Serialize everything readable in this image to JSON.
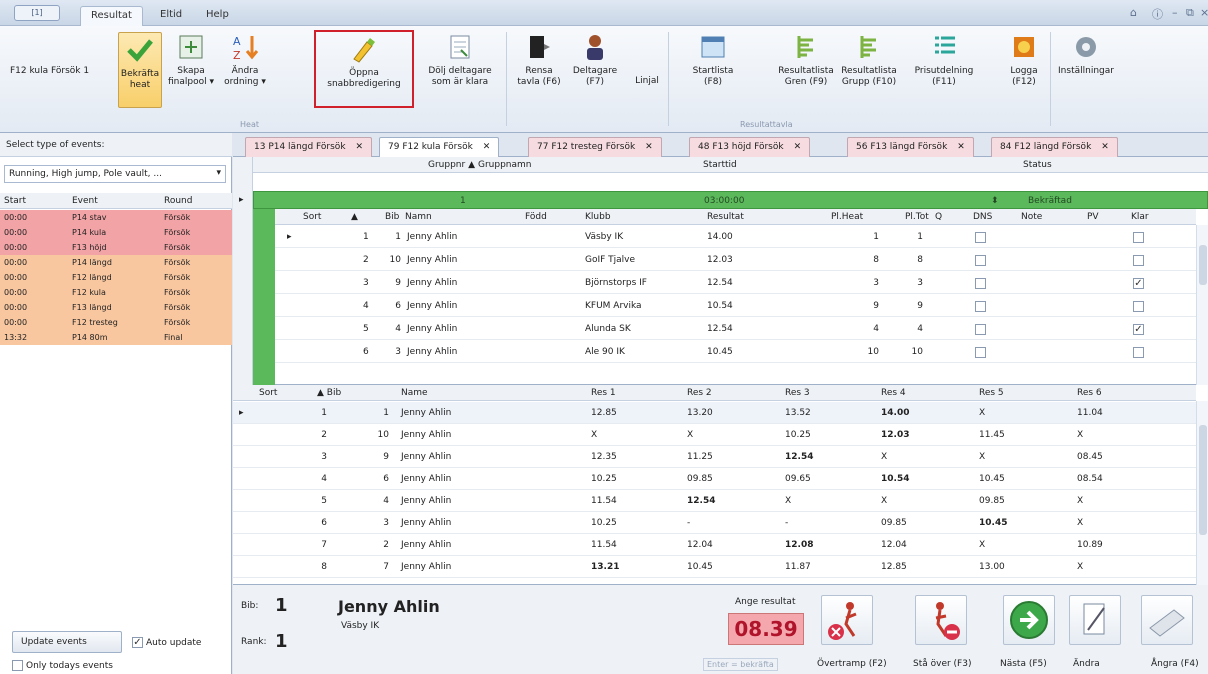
{
  "titlebar": {
    "qat": "[1]",
    "tabs": [
      "Resultat",
      "Eltid",
      "Help"
    ]
  },
  "ribbon": {
    "event_label": "F12 kula Försök 1",
    "buttons": [
      "Bekräfta heat",
      "Skapa finalpool ▾",
      "Ändra ordning ▾",
      "Öppna snabbredigering",
      "Dölj deltagare som är klara",
      "Rensa tavla (F6)",
      "Deltagare (F7)",
      "Linjal",
      "Startlista (F8)",
      "Resultatlista Gren (F9)",
      "Resultatlista Grupp (F10)",
      "Prisutdelning (F11)",
      "Logga (F12)",
      "Inställningar"
    ],
    "groups": [
      "Heat",
      "Resultattavla"
    ]
  },
  "left": {
    "title": "Select type of events:",
    "combo": "Running, High jump, Pole vault, ...",
    "headers": [
      "Start",
      "Event",
      "Round"
    ],
    "rows": [
      {
        "start": "00:00",
        "event": "P14 stav",
        "round": "Försök",
        "color": "pink"
      },
      {
        "start": "00:00",
        "event": "P14 kula",
        "round": "Försök",
        "color": "pink"
      },
      {
        "start": "00:00",
        "event": "F13 höjd",
        "round": "Försök",
        "color": "pink"
      },
      {
        "start": "00:00",
        "event": "P14 längd",
        "round": "Försök",
        "color": "orange"
      },
      {
        "start": "00:00",
        "event": "F12 längd",
        "round": "Försök",
        "color": "orange"
      },
      {
        "start": "00:00",
        "event": "F12 kula",
        "round": "Försök",
        "color": "orange"
      },
      {
        "start": "00:00",
        "event": "F13 längd",
        "round": "Försök",
        "color": "orange"
      },
      {
        "start": "00:00",
        "event": "F12 tresteg",
        "round": "Försök",
        "color": "orange"
      },
      {
        "start": "13:32",
        "event": "P14 80m",
        "round": "Final",
        "color": "orange"
      }
    ],
    "update_button": "Update events",
    "auto_update": "Auto update",
    "only_today": "Only todays events"
  },
  "doc_tabs": [
    "13 P14 längd Försök",
    "79 F12 kula Försök",
    "77 F12 tresteg Försök",
    "48 F13 höjd Försök",
    "56 F13 längd Försök",
    "84 F12 längd Försök"
  ],
  "grid1": {
    "group_headers": [
      "Gruppnr ▲",
      "Gruppnamn",
      "Starttid",
      "Status"
    ],
    "group_row": {
      "nr": "1",
      "time": "03:00:00",
      "status": "Bekräftad"
    },
    "headers": [
      "Sort",
      "Bib",
      "Namn",
      "Född",
      "Klubb",
      "Resultat",
      "Pl.Heat",
      "Pl.Tot",
      "Q",
      "DNS",
      "Note",
      "PV",
      "Klar"
    ],
    "rows": [
      {
        "sort": "1",
        "bib": "1",
        "name": "Jenny Ahlin",
        "club": "Väsby IK",
        "res": "14.00",
        "plheat": "1",
        "pltot": "1",
        "klar": ""
      },
      {
        "sort": "2",
        "bib": "10",
        "name": "Jenny Ahlin",
        "club": "GoIF Tjalve",
        "res": "12.03",
        "plheat": "8",
        "pltot": "8",
        "klar": ""
      },
      {
        "sort": "3",
        "bib": "9",
        "name": "Jenny Ahlin",
        "club": "Björnstorps IF",
        "res": "12.54",
        "plheat": "3",
        "pltot": "3",
        "klar": "✓"
      },
      {
        "sort": "4",
        "bib": "6",
        "name": "Jenny Ahlin",
        "club": "KFUM Arvika",
        "res": "10.54",
        "plheat": "9",
        "pltot": "9",
        "klar": ""
      },
      {
        "sort": "5",
        "bib": "4",
        "name": "Jenny Ahlin",
        "club": "Alunda SK",
        "res": "12.54",
        "plheat": "4",
        "pltot": "4",
        "klar": "✓"
      },
      {
        "sort": "6",
        "bib": "3",
        "name": "Jenny Ahlin",
        "club": "Ale 90 IK",
        "res": "10.45",
        "plheat": "10",
        "pltot": "10",
        "klar": ""
      }
    ]
  },
  "grid2": {
    "headers": [
      "Sort",
      "▲ Bib",
      "Name",
      "Res 1",
      "Res 2",
      "Res 3",
      "Res 4",
      "Res 5",
      "Res 6"
    ],
    "rows": [
      {
        "sort": "1",
        "bib": "1",
        "name": "Jenny Ahlin",
        "r": [
          "12.85",
          "13.20",
          "13.52",
          "14.00",
          "X",
          "11.04"
        ],
        "best": 3
      },
      {
        "sort": "2",
        "bib": "10",
        "name": "Jenny Ahlin",
        "r": [
          "X",
          "X",
          "10.25",
          "12.03",
          "11.45",
          "X"
        ],
        "best": 3
      },
      {
        "sort": "3",
        "bib": "9",
        "name": "Jenny Ahlin",
        "r": [
          "12.35",
          "11.25",
          "12.54",
          "X",
          "X",
          "08.45"
        ],
        "best": 2
      },
      {
        "sort": "4",
        "bib": "6",
        "name": "Jenny Ahlin",
        "r": [
          "10.25",
          "09.85",
          "09.65",
          "10.54",
          "10.45",
          "08.54"
        ],
        "best": 3
      },
      {
        "sort": "5",
        "bib": "4",
        "name": "Jenny Ahlin",
        "r": [
          "11.54",
          "12.54",
          "X",
          "X",
          "09.85",
          "X"
        ],
        "best": 1
      },
      {
        "sort": "6",
        "bib": "3",
        "name": "Jenny Ahlin",
        "r": [
          "10.25",
          "-",
          "-",
          "09.85",
          "10.45",
          "X"
        ],
        "best": 4
      },
      {
        "sort": "7",
        "bib": "2",
        "name": "Jenny Ahlin",
        "r": [
          "11.54",
          "12.04",
          "12.08",
          "12.04",
          "X",
          "10.89"
        ],
        "best": 2
      },
      {
        "sort": "8",
        "bib": "7",
        "name": "Jenny Ahlin",
        "r": [
          "13.21",
          "10.45",
          "11.87",
          "12.85",
          "13.00",
          "X"
        ],
        "best": 0
      }
    ]
  },
  "bottom": {
    "bib_label": "Bib:",
    "bib": "1",
    "rank_label": "Rank:",
    "rank": "1",
    "name": "Jenny Ahlin",
    "club": "Väsby IK",
    "ange": "Ange resultat",
    "value": "08.39",
    "enter": "Enter = bekräfta",
    "buttons": [
      "Övertramp (F2)",
      "Stå över (F3)",
      "Nästa (F5)",
      "Ändra",
      "Ångra (F4)"
    ]
  }
}
